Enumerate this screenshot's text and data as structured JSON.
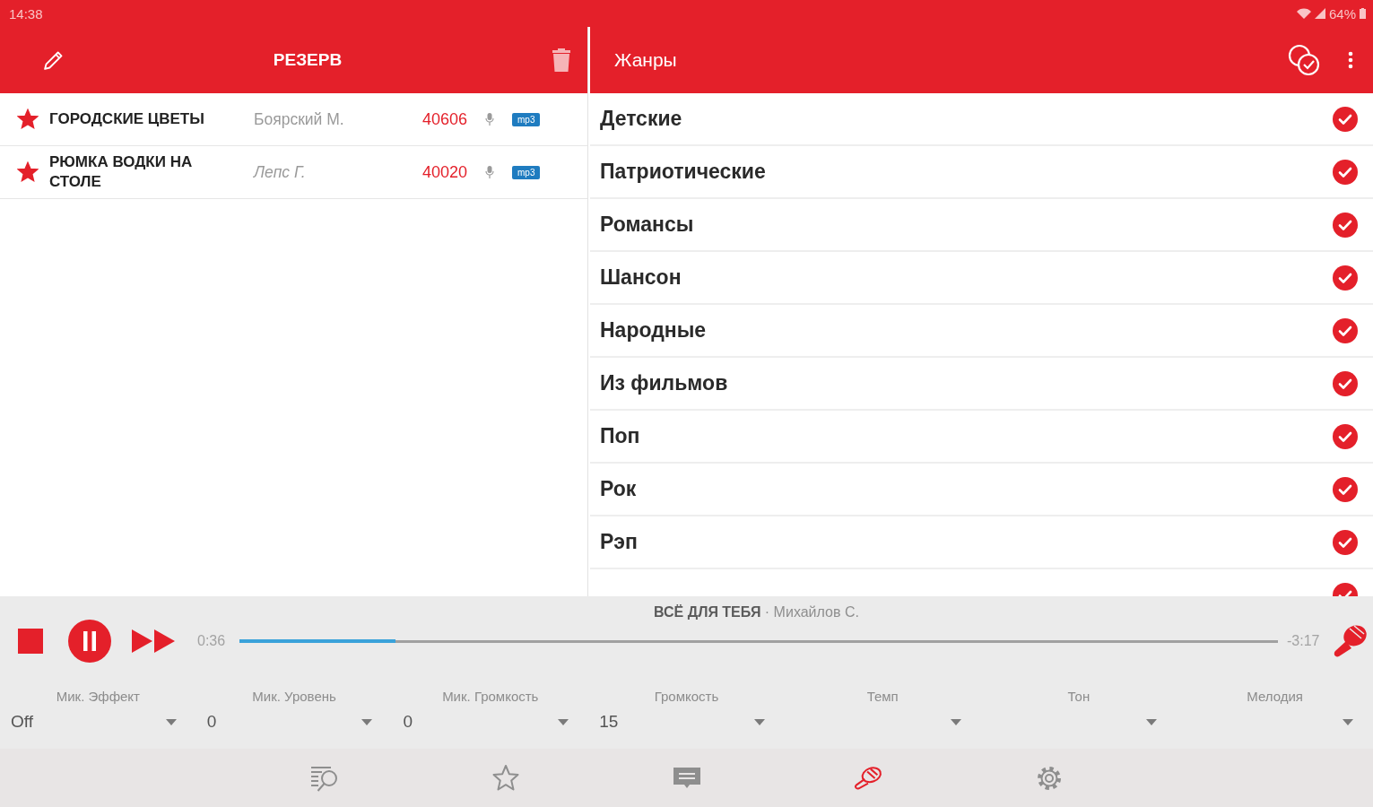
{
  "status_bar": {
    "time": "14:38",
    "battery": "64%"
  },
  "reserve": {
    "title": "РЕЗЕРВ",
    "songs": [
      {
        "title": "ГОРОДСКИЕ ЦВЕТЫ",
        "artist": "Боярский М.",
        "number": "40606",
        "format": "mp3",
        "starred": true
      },
      {
        "title": "РЮМКА ВОДКИ НА СТОЛЕ",
        "artist": "Лепс Г.",
        "number": "40020",
        "format": "mp3",
        "starred": true
      }
    ]
  },
  "genres": {
    "title": "Жанры",
    "items": [
      {
        "label": "Детские",
        "checked": true
      },
      {
        "label": "Патриотические",
        "checked": true
      },
      {
        "label": "Романсы",
        "checked": true
      },
      {
        "label": "Шансон",
        "checked": true
      },
      {
        "label": "Народные",
        "checked": true
      },
      {
        "label": "Из фильмов",
        "checked": true
      },
      {
        "label": "Поп",
        "checked": true
      },
      {
        "label": "Рок",
        "checked": true
      },
      {
        "label": "Рэп",
        "checked": true
      },
      {
        "checked": true
      }
    ]
  },
  "player": {
    "title": "ВСЁ ДЛЯ ТЕБЯ",
    "separator": "·",
    "artist": "Михайлов С.",
    "elapsed": "0:36",
    "remaining": "-3:17",
    "level": 0.15,
    "playing": true
  },
  "controls": [
    {
      "label": "Мик. Эффект",
      "value": "Off"
    },
    {
      "label": "Мик. Уровень",
      "value": "0"
    },
    {
      "label": "Мик. Громкость",
      "value": "0"
    },
    {
      "label": "Громкость",
      "value": "15"
    },
    {
      "label": "Темп"
    },
    {
      "label": "Тон"
    },
    {
      "label": "Мелодия"
    }
  ],
  "nav": [
    {
      "kind": "search",
      "selected": false
    },
    {
      "kind": "favorites",
      "selected": false
    },
    {
      "kind": "new",
      "selected": false
    },
    {
      "kind": "karaoke",
      "selected": true
    },
    {
      "kind": "settings",
      "selected": false
    }
  ]
}
